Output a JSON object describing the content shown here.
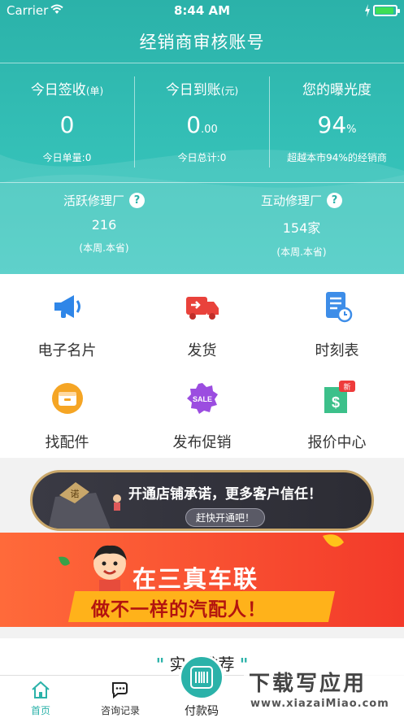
{
  "status_bar": {
    "carrier": "Carrier",
    "time": "8:44 AM"
  },
  "header": {
    "title": "经销商审核账号"
  },
  "stats": [
    {
      "label": "今日签收",
      "unit": "(单)",
      "value": "0",
      "value_suffix": "",
      "sub": "今日单量:0"
    },
    {
      "label": "今日到账",
      "unit": "(元)",
      "value": "0",
      "value_suffix": ".00",
      "sub": "今日总计:0"
    },
    {
      "label": "您的曝光度",
      "unit": "",
      "value": "94",
      "value_suffix": "%",
      "sub": "超越本市94%的经销商"
    }
  ],
  "factories": [
    {
      "label": "活跃修理厂",
      "help": "?",
      "value": "216",
      "sub": "(本周.本省)"
    },
    {
      "label": "互动修理厂",
      "help": "?",
      "value": "154家",
      "sub": "(本周.本省)"
    }
  ],
  "grid": [
    {
      "label": "电子名片",
      "icon": "megaphone-icon"
    },
    {
      "label": "发货",
      "icon": "truck-icon"
    },
    {
      "label": "时刻表",
      "icon": "schedule-icon"
    },
    {
      "label": "找配件",
      "icon": "parts-box-icon"
    },
    {
      "label": "发布促销",
      "icon": "sale-badge-icon"
    },
    {
      "label": "报价中心",
      "icon": "quote-icon"
    }
  ],
  "promo": {
    "badge": "诺",
    "text": "开通店铺承诺，更多客户信任！",
    "button": "赶快开通吧！"
  },
  "banner": {
    "line1": "在三真车联",
    "line2": "做不一样的汽配人！"
  },
  "recommend": {
    "title": "实力推荐",
    "quote_left": "\"",
    "quote_right": "\""
  },
  "quote_badge": "新",
  "sale_badge": "SALE",
  "tabbar": {
    "tabs": [
      {
        "label": "首页",
        "icon": "home-icon"
      },
      {
        "label": "咨询记录",
        "icon": "chat-icon"
      }
    ],
    "pay_label": "付款码"
  },
  "watermark": {
    "line1": "下载写应用",
    "line2": "www.xiazaiMiao.com"
  },
  "colors": {
    "teal": "#2bb2a9",
    "orange": "#ff6a3a",
    "gold": "#c9a76a"
  }
}
